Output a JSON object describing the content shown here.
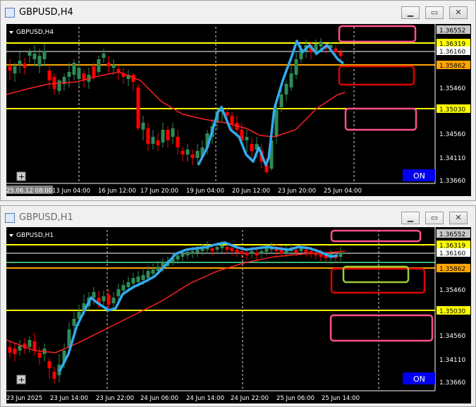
{
  "top": {
    "window_title": "GBPUSD,H4",
    "symbol_label": "GBPUSD,H4",
    "price_labels": [
      {
        "text": "1.36552",
        "kind": "scale"
      },
      {
        "text": "1.36319",
        "kind": "yellow"
      },
      {
        "text": "1.36160",
        "kind": "white"
      },
      {
        "text": "1.35862",
        "kind": "orange"
      },
      {
        "text": "1.35460",
        "kind": "scale"
      },
      {
        "text": "1.35030",
        "kind": "yellow"
      },
      {
        "text": "1.34560",
        "kind": "scale"
      },
      {
        "text": "1.34110",
        "kind": "scale"
      },
      {
        "text": "1.33660",
        "kind": "scale"
      }
    ],
    "time_labels": [
      "25.06.12 08:00",
      "13 Jun 04:00",
      "16 Jun 12:00",
      "17 Jun 20:00",
      "19 Jun 04:00",
      "20 Jun 12:00",
      "23 Jun 20:00",
      "25 Jun 04:00"
    ],
    "on_label": "ON"
  },
  "bottom": {
    "window_title": "GBPUSD,H1",
    "symbol_label": "GBPUSD,H1",
    "price_labels": [
      {
        "text": "1.36552",
        "kind": "scale"
      },
      {
        "text": "1.36319",
        "kind": "yellow"
      },
      {
        "text": "1.36160",
        "kind": "white"
      },
      {
        "text": "1.35862",
        "kind": "orange"
      },
      {
        "text": "1.35460",
        "kind": "scale"
      },
      {
        "text": "1.35030",
        "kind": "yellow"
      },
      {
        "text": "1.34560",
        "kind": "scale"
      },
      {
        "text": "1.34110",
        "kind": "scale"
      },
      {
        "text": "1.33660",
        "kind": "scale"
      }
    ],
    "time_labels": [
      "23 Jun 2025",
      "23 Jun 14:00",
      "23 Jun 22:00",
      "24 Jun 06:00",
      "24 Jun 14:00",
      "24 Jun 22:00",
      "25 Jun 06:00",
      "25 Jun 14:00"
    ],
    "on_label": "ON"
  },
  "colors": {
    "bull": "#2e8b57",
    "bear": "#ff0000",
    "ma": "#ff2020",
    "zigzag": "#33aaee",
    "yellow_line": "#ffff00",
    "orange_line": "#ffa500",
    "pink_box": "#ff4f8b",
    "red_box": "#dd0000",
    "green_box": "#9acd32",
    "on_button": "#0000ee"
  },
  "icons": {
    "minimize": "minimize-icon",
    "maximize": "maximize-icon",
    "close": "close-icon",
    "app": "chart-window-icon"
  }
}
